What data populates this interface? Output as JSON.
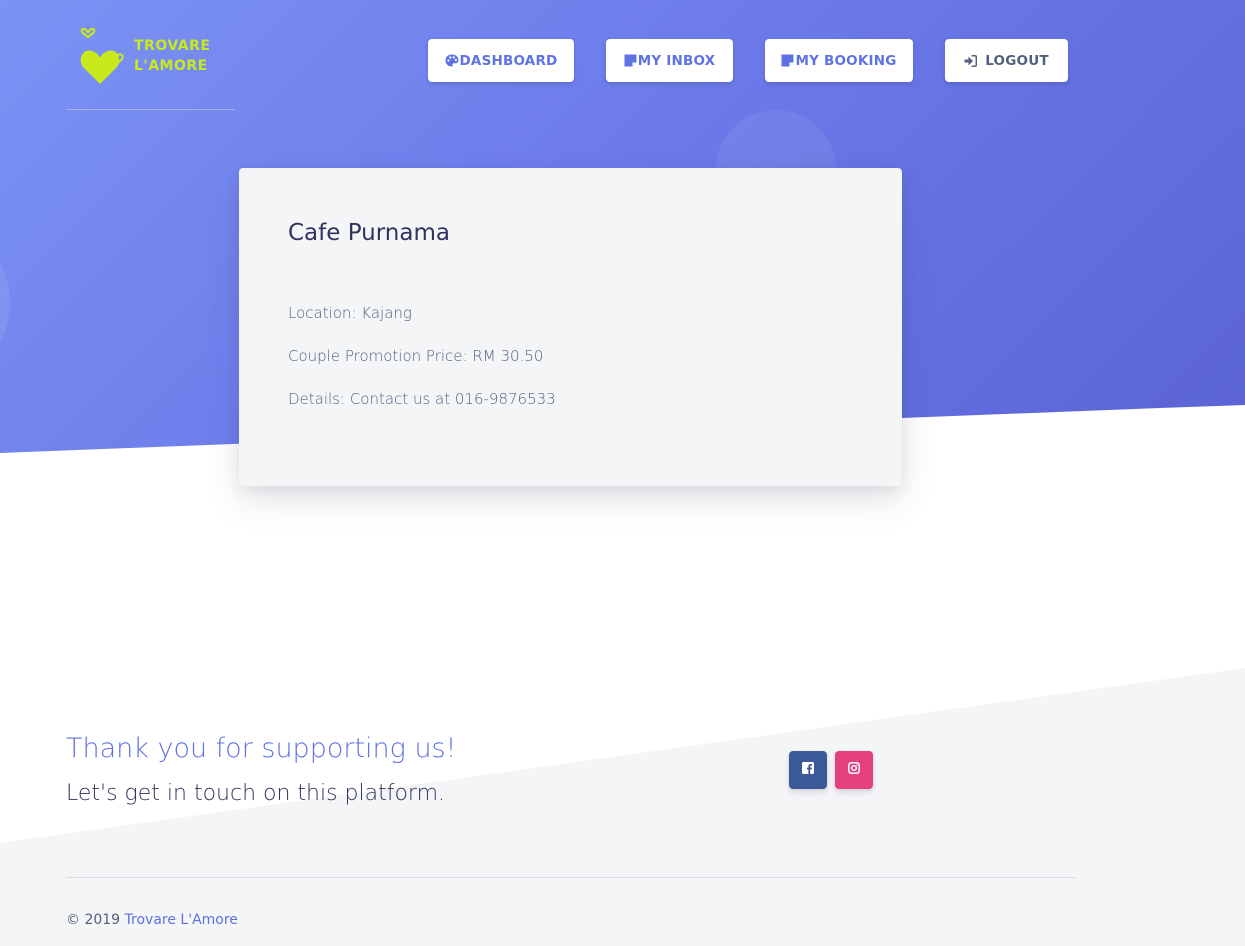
{
  "brand": {
    "name_line1": "TROVARE",
    "name_line2": "L'AMORE",
    "logo_color": "#c8ea1d"
  },
  "nav": {
    "dashboard_label": "DASHBOARD",
    "dashboard_icon": "palette-icon",
    "inbox_label": "MY INBOX",
    "inbox_icon": "note-icon",
    "booking_label": "MY BOOKING",
    "booking_icon": "note-icon",
    "logout_label": "LOGOUT",
    "logout_icon": "sign-in-icon"
  },
  "venue": {
    "name": "Cafe Purnama",
    "location": "Location: Kajang",
    "price": "Couple Promotion Price: RM 30.50",
    "details": "Details: Contact us at 016-9876533"
  },
  "footer": {
    "thanks": "Thank you for supporting us!",
    "touch": "Let's get in touch on this platform.",
    "copyright_prefix": "© 2019 ",
    "copyright_link": "Trovare L'Amore",
    "facebook_icon": "facebook-icon",
    "instagram_icon": "instagram-icon"
  },
  "colors": {
    "primary": "#5e72e4",
    "hero_start": "#7b93f5",
    "hero_end": "#5b63d3",
    "facebook": "#3b5999",
    "instagram": "#e4407b"
  }
}
